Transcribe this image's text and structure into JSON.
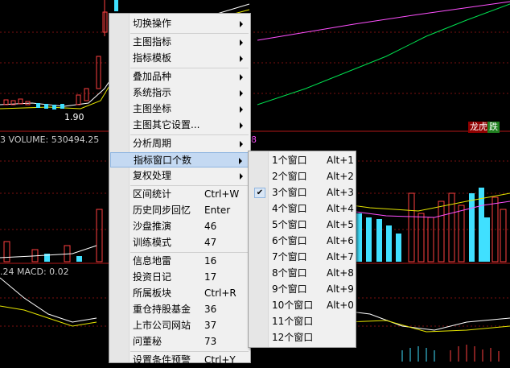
{
  "chart": {
    "price_low": "1.90",
    "volume_label": "3  VOLUME: 530494.25",
    "right_num": "8",
    "macd_label": ".24  MACD: 0.02",
    "tag_lhb": "龙虎",
    "tag_up": "跌"
  },
  "menu": [
    {
      "label": "切换操作",
      "shortcut": "",
      "arrow": true,
      "sep_before": false,
      "checked": false,
      "highlight": false
    },
    {
      "label": "主图指标",
      "shortcut": "",
      "arrow": true,
      "sep_before": true,
      "checked": false,
      "highlight": false
    },
    {
      "label": "指标模板",
      "shortcut": "",
      "arrow": true,
      "sep_before": false,
      "checked": false,
      "highlight": false
    },
    {
      "label": "叠加品种",
      "shortcut": "",
      "arrow": true,
      "sep_before": true,
      "checked": false,
      "highlight": false
    },
    {
      "label": "系统指示",
      "shortcut": "",
      "arrow": true,
      "sep_before": false,
      "checked": false,
      "highlight": false
    },
    {
      "label": "主图坐标",
      "shortcut": "",
      "arrow": true,
      "sep_before": false,
      "checked": false,
      "highlight": false
    },
    {
      "label": "主图其它设置...",
      "shortcut": "",
      "arrow": true,
      "sep_before": false,
      "checked": false,
      "highlight": false
    },
    {
      "label": "分析周期",
      "shortcut": "",
      "arrow": true,
      "sep_before": true,
      "checked": false,
      "highlight": false
    },
    {
      "label": "指标窗口个数",
      "shortcut": "",
      "arrow": true,
      "sep_before": false,
      "checked": false,
      "highlight": true
    },
    {
      "label": "复权处理",
      "shortcut": "",
      "arrow": true,
      "sep_before": false,
      "checked": false,
      "highlight": false
    },
    {
      "label": "区间统计",
      "shortcut": "Ctrl+W",
      "arrow": false,
      "sep_before": true,
      "checked": false,
      "highlight": false
    },
    {
      "label": "历史同步回忆",
      "shortcut": "Enter",
      "arrow": false,
      "sep_before": false,
      "checked": false,
      "highlight": false
    },
    {
      "label": "沙盘推演",
      "shortcut": "46",
      "arrow": false,
      "sep_before": false,
      "checked": false,
      "highlight": false
    },
    {
      "label": "训练模式",
      "shortcut": "47",
      "arrow": false,
      "sep_before": false,
      "checked": false,
      "highlight": false
    },
    {
      "label": "信息地雷",
      "shortcut": "16",
      "arrow": false,
      "sep_before": true,
      "checked": false,
      "highlight": false
    },
    {
      "label": "投资日记",
      "shortcut": "17",
      "arrow": false,
      "sep_before": false,
      "checked": false,
      "highlight": false
    },
    {
      "label": "所属板块",
      "shortcut": "Ctrl+R",
      "arrow": false,
      "sep_before": false,
      "checked": false,
      "highlight": false
    },
    {
      "label": "重仓持股基金",
      "shortcut": "36",
      "arrow": false,
      "sep_before": false,
      "checked": false,
      "highlight": false
    },
    {
      "label": "上市公司网站",
      "shortcut": "37",
      "arrow": false,
      "sep_before": false,
      "checked": false,
      "highlight": false
    },
    {
      "label": "问董秘",
      "shortcut": "73",
      "arrow": false,
      "sep_before": false,
      "checked": false,
      "highlight": false
    },
    {
      "label": "设置条件预警",
      "shortcut": "Ctrl+Y",
      "arrow": false,
      "sep_before": true,
      "checked": false,
      "highlight": false
    }
  ],
  "submenu": [
    {
      "label": "1个窗口",
      "shortcut": "Alt+1",
      "checked": false
    },
    {
      "label": "2个窗口",
      "shortcut": "Alt+2",
      "checked": false
    },
    {
      "label": "3个窗口",
      "shortcut": "Alt+3",
      "checked": true
    },
    {
      "label": "4个窗口",
      "shortcut": "Alt+4",
      "checked": false
    },
    {
      "label": "5个窗口",
      "shortcut": "Alt+5",
      "checked": false
    },
    {
      "label": "6个窗口",
      "shortcut": "Alt+6",
      "checked": false
    },
    {
      "label": "7个窗口",
      "shortcut": "Alt+7",
      "checked": false
    },
    {
      "label": "8个窗口",
      "shortcut": "Alt+8",
      "checked": false
    },
    {
      "label": "9个窗口",
      "shortcut": "Alt+9",
      "checked": false
    },
    {
      "label": "10个窗口",
      "shortcut": "Alt+0",
      "checked": false
    },
    {
      "label": "11个窗口",
      "shortcut": "",
      "checked": false
    },
    {
      "label": "12个窗口",
      "shortcut": "",
      "checked": false
    }
  ]
}
